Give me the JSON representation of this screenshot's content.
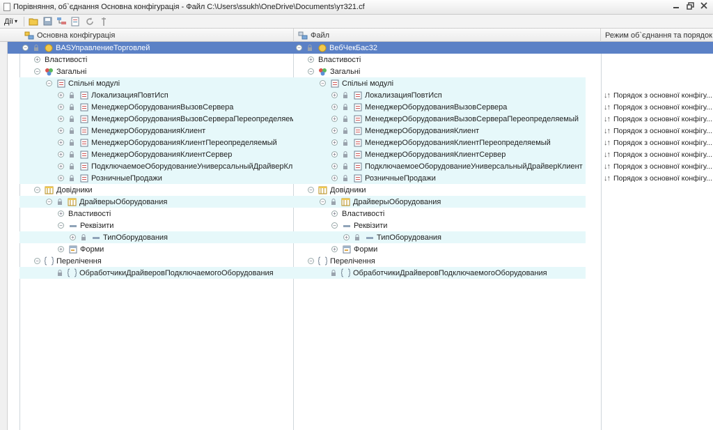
{
  "window": {
    "title": "Порівняння, об`єднання Основна конфігурація - Файл C:\\Users\\ssukh\\OneDrive\\Documents\\ут321.cf"
  },
  "toolbar": {
    "actions_label": "Дії",
    "actions_arrow": "▾"
  },
  "columns": {
    "left": "Основна конфігурація",
    "right": "Файл",
    "mode": "Режим об`єднання та порядок ..."
  },
  "tree": [
    {
      "level": 0,
      "toggle": "-",
      "lock": true,
      "icon": "config",
      "left": "BASУправлениеТорговлей",
      "right": "ВебЧекБас32",
      "mode": "",
      "hl": false,
      "selected": true
    },
    {
      "level": 1,
      "toggle": "+",
      "lock": false,
      "icon": "none",
      "left": "Властивості",
      "right": "Властивості",
      "mode": "",
      "hl": false,
      "selected": false
    },
    {
      "level": 1,
      "toggle": "-",
      "lock": false,
      "icon": "common",
      "left": "Загальні",
      "right": "Загальні",
      "mode": "",
      "hl": false,
      "selected": false
    },
    {
      "level": 2,
      "toggle": "-",
      "lock": false,
      "icon": "module",
      "left": "Спільні модулі",
      "right": "Спільні модулі",
      "mode": "",
      "hl": true,
      "selected": false
    },
    {
      "level": 3,
      "toggle": "+",
      "lock": true,
      "icon": "module",
      "left": "ЛокализацияПовтИсп",
      "right": "ЛокализацияПовтИсп",
      "mode": "Порядок з основної конфігу...",
      "hl": true,
      "selected": false
    },
    {
      "level": 3,
      "toggle": "+",
      "lock": true,
      "icon": "module",
      "left": "МенеджерОборудованияВызовСервера",
      "right": "МенеджерОборудованияВызовСервера",
      "mode": "Порядок з основної конфігу...",
      "hl": true,
      "selected": false
    },
    {
      "level": 3,
      "toggle": "+",
      "lock": true,
      "icon": "module",
      "left": "МенеджерОборудованияВызовСервераПереопределяемый",
      "right": "МенеджерОборудованияВызовСервераПереопределяемый",
      "mode": "Порядок з основної конфігу...",
      "hl": true,
      "selected": false
    },
    {
      "level": 3,
      "toggle": "+",
      "lock": true,
      "icon": "module",
      "left": "МенеджерОборудованияКлиент",
      "right": "МенеджерОборудованияКлиент",
      "mode": "Порядок з основної конфігу...",
      "hl": true,
      "selected": false
    },
    {
      "level": 3,
      "toggle": "+",
      "lock": true,
      "icon": "module",
      "left": "МенеджерОборудованияКлиентПереопределяемый",
      "right": "МенеджерОборудованияКлиентПереопределяемый",
      "mode": "Порядок з основної конфігу...",
      "hl": true,
      "selected": false
    },
    {
      "level": 3,
      "toggle": "+",
      "lock": true,
      "icon": "module",
      "left": "МенеджерОборудованияКлиентСервер",
      "right": "МенеджерОборудованияКлиентСервер",
      "mode": "Порядок з основної конфігу...",
      "hl": true,
      "selected": false
    },
    {
      "level": 3,
      "toggle": "+",
      "lock": true,
      "icon": "module",
      "left": "ПодключаемоеОборудованиеУниверсальныйДрайверКлие...",
      "right": "ПодключаемоеОборудованиеУниверсальныйДрайверКлиент",
      "mode": "Порядок з основної конфігу...",
      "hl": true,
      "selected": false
    },
    {
      "level": 3,
      "toggle": "+",
      "lock": true,
      "icon": "module",
      "left": "РозничныеПродажи",
      "right": "РозничныеПродажи",
      "mode": "Порядок з основної конфігу...",
      "hl": true,
      "selected": false
    },
    {
      "level": 1,
      "toggle": "-",
      "lock": false,
      "icon": "catalog",
      "left": "Довідники",
      "right": "Довідники",
      "mode": "",
      "hl": false,
      "selected": false
    },
    {
      "level": 2,
      "toggle": "-",
      "lock": true,
      "icon": "catalog",
      "left": "ДрайверыОборудования",
      "right": "ДрайверыОборудования",
      "mode": "",
      "hl": true,
      "selected": false
    },
    {
      "level": 3,
      "toggle": "+",
      "lock": false,
      "icon": "none",
      "left": "Властивості",
      "right": "Властивості",
      "mode": "",
      "hl": false,
      "selected": false
    },
    {
      "level": 3,
      "toggle": "-",
      "lock": false,
      "icon": "attr",
      "left": "Реквізити",
      "right": "Реквізити",
      "mode": "",
      "hl": false,
      "selected": false
    },
    {
      "level": 4,
      "toggle": "+",
      "lock": true,
      "icon": "attr",
      "left": "ТипОборудования",
      "right": "ТипОборудования",
      "mode": "",
      "hl": true,
      "selected": false
    },
    {
      "level": 3,
      "toggle": "+",
      "lock": false,
      "icon": "form",
      "left": "Форми",
      "right": "Форми",
      "mode": "",
      "hl": false,
      "selected": false
    },
    {
      "level": 1,
      "toggle": "-",
      "lock": false,
      "icon": "enum",
      "left": "Перелічення",
      "right": "Перелічення",
      "mode": "",
      "hl": false,
      "selected": false
    },
    {
      "level": 2,
      "toggle": "",
      "lock": true,
      "icon": "enum",
      "left": "ОбработчикиДрайверовПодключаемогоОборудования",
      "right": "ОбработчикиДрайверовПодключаемогоОборудования",
      "mode": "",
      "hl": true,
      "selected": false
    }
  ],
  "mode_arrows": "↓↑"
}
